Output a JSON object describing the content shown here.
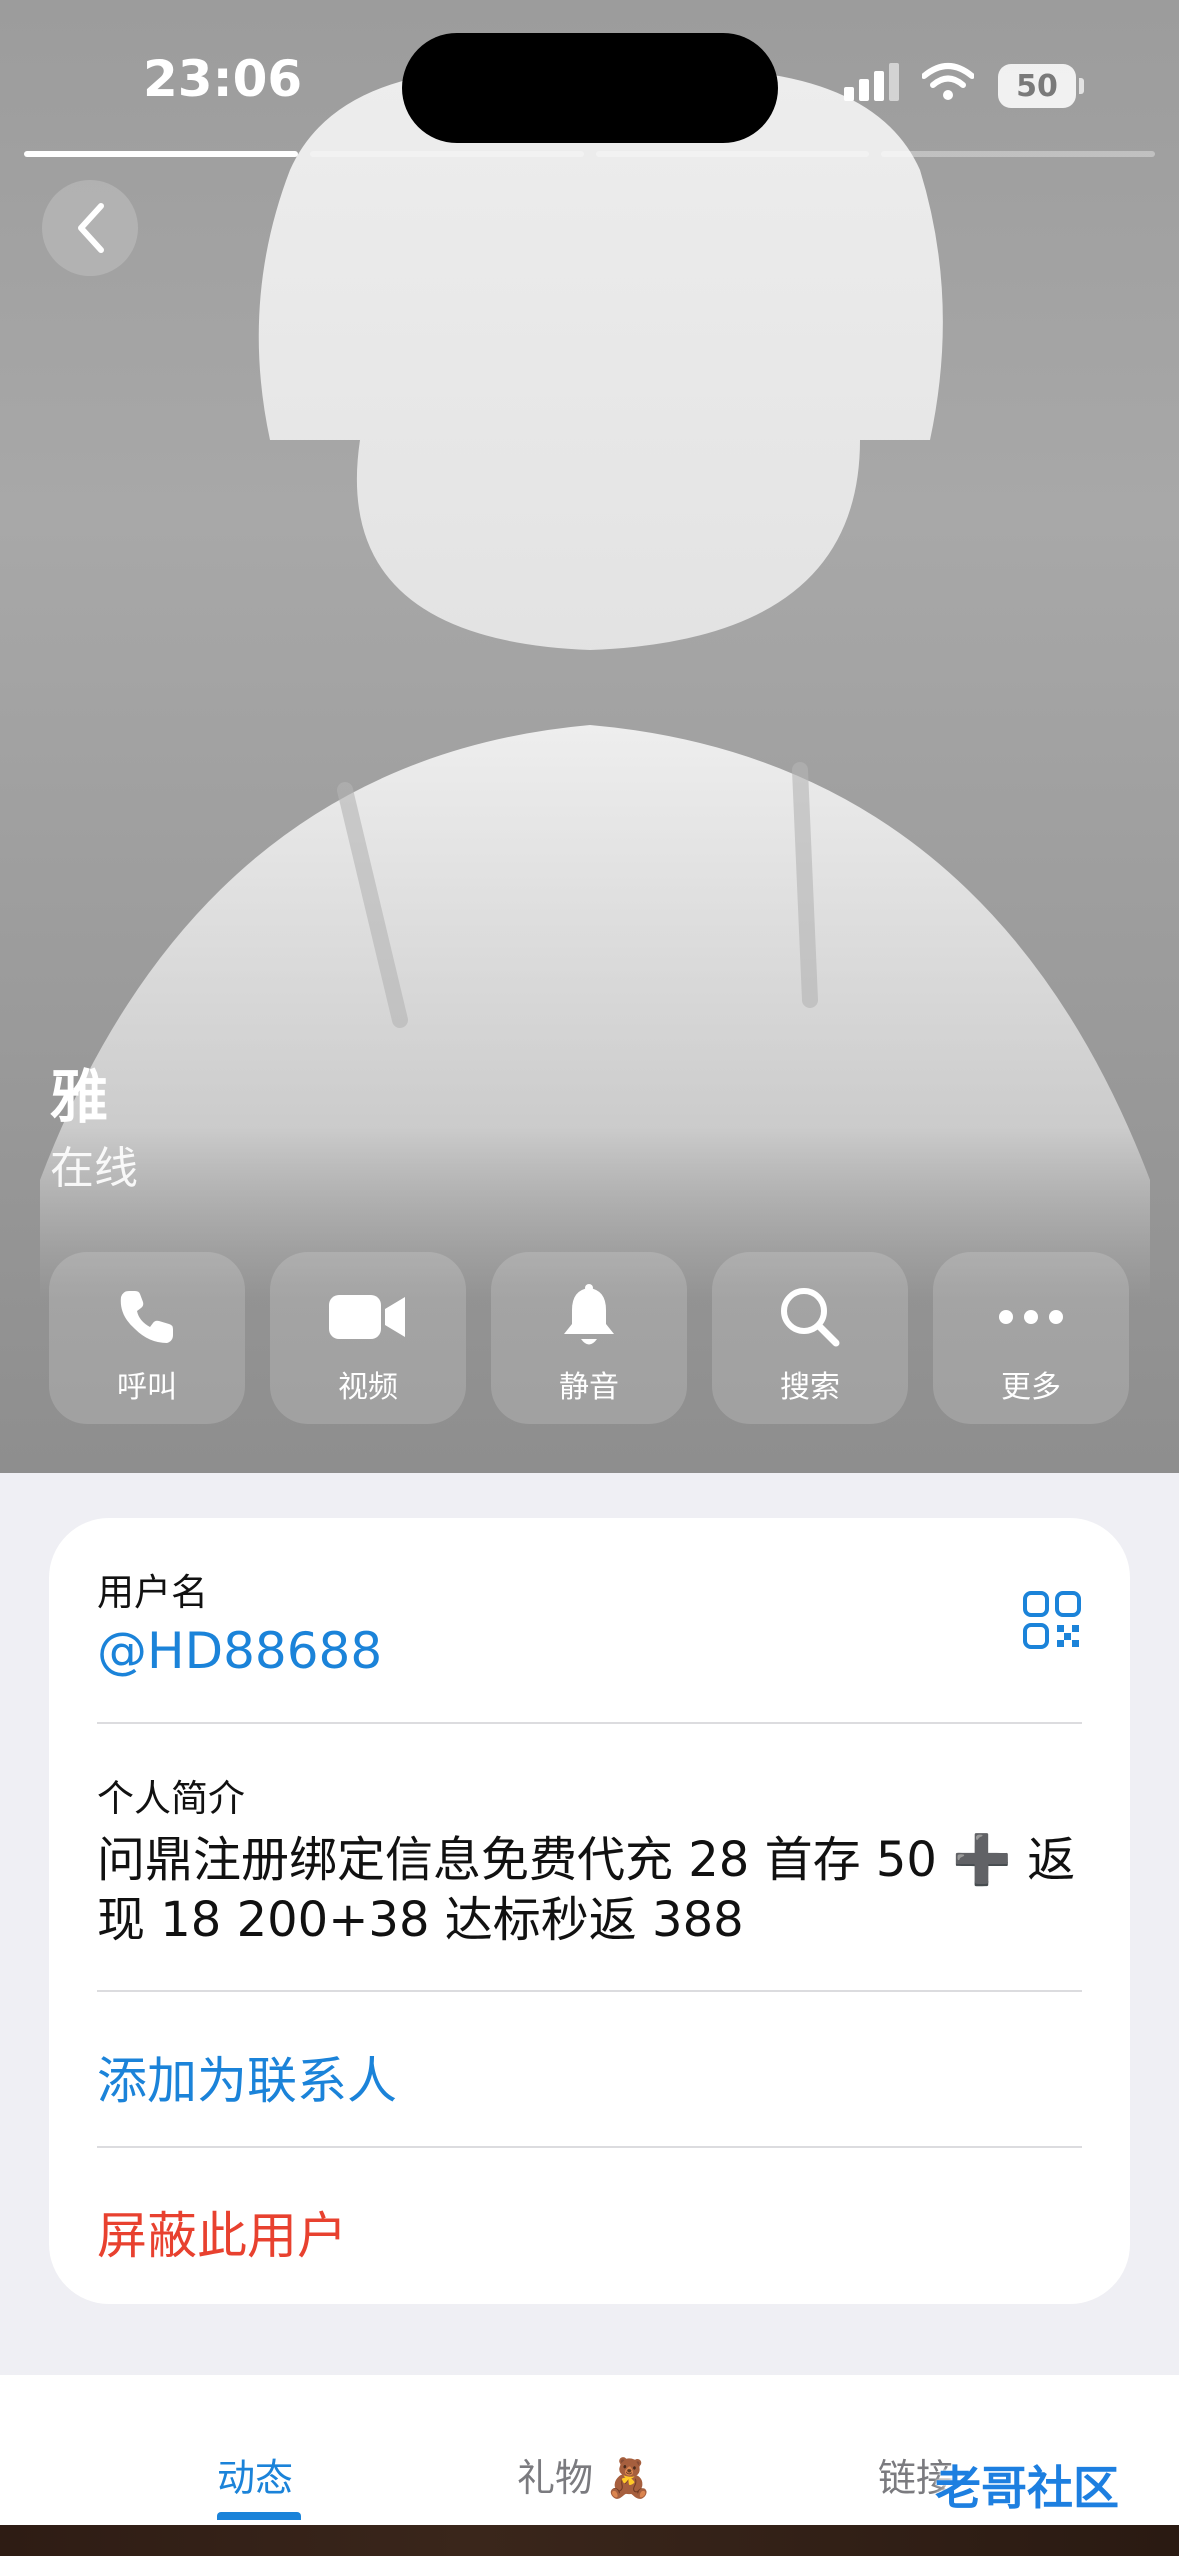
{
  "status_bar": {
    "time": "23:06",
    "battery": "50"
  },
  "profile": {
    "name": "雅",
    "status": "在线"
  },
  "actions": [
    {
      "label": "呼叫",
      "icon": "phone-icon"
    },
    {
      "label": "视频",
      "icon": "video-camera-icon"
    },
    {
      "label": "静音",
      "icon": "bell-icon"
    },
    {
      "label": "搜索",
      "icon": "search-icon"
    },
    {
      "label": "更多",
      "icon": "more-dots-icon"
    }
  ],
  "info": {
    "username_label": "用户名",
    "username": "@HD88688",
    "bio_label": "个人简介",
    "bio": "问鼎注册绑定信息免费代充 28 首存 50 ➕ 返现 18 200+38 达标秒返 388",
    "add_contact": "添加为联系人",
    "block_user": "屏蔽此用户"
  },
  "tabs": [
    {
      "label": "动态",
      "active": true
    },
    {
      "label": "礼物 🧸",
      "active": false
    },
    {
      "label": "链接",
      "active": false
    }
  ],
  "watermark": "老哥社区",
  "colors": {
    "accent": "#1b83d9",
    "danger": "#e8412f"
  }
}
